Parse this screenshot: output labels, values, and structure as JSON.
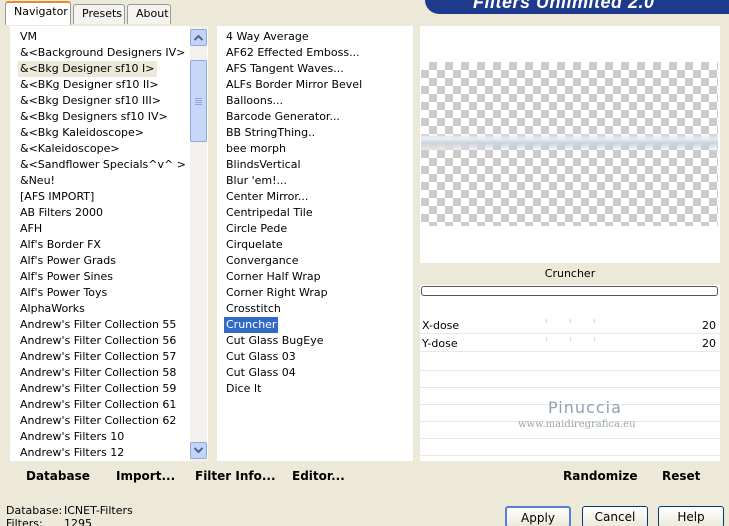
{
  "tabs": [
    "Navigator",
    "Presets",
    "About"
  ],
  "banner_title": "Filters Unlimited 2.0",
  "categories": [
    "VM",
    "&<Background Designers IV>",
    "&<Bkg Designer sf10 I>",
    "&<BKg Designer sf10 II>",
    "&<Bkg Designer sf10 III>",
    "&<Bkg Designers sf10 IV>",
    "&<Bkg Kaleidoscope>",
    "&<Kaleidoscope>",
    "&<Sandflower Specials^v^ >",
    "&Neu!",
    "[AFS IMPORT]",
    "AB Filters 2000",
    "AFH",
    "Alf's Border FX",
    "Alf's Power Grads",
    "Alf's Power Sines",
    "Alf's Power Toys",
    "AlphaWorks",
    "Andrew's Filter Collection 55",
    "Andrew's Filter Collection 56",
    "Andrew's Filter Collection 57",
    "Andrew's Filter Collection 58",
    "Andrew's Filter Collection 59",
    "Andrew's Filter Collection 61",
    "Andrew's Filter Collection 62",
    "Andrew's Filters 10",
    "Andrew's Filters 12"
  ],
  "selected_category": "&<Bkg Designer sf10 I>",
  "filters": [
    "4 Way Average",
    "AF62 Effected Emboss...",
    "AFS Tangent Waves...",
    "ALFs Border Mirror Bevel",
    "Balloons...",
    "Barcode Generator...",
    "BB StringThing..",
    "bee morph",
    "BlindsVertical",
    "Blur 'em!...",
    "Center Mirror...",
    "Centripedal Tile",
    "Circle Pede",
    "Cirquelate",
    "Convergance",
    "Corner Half Wrap",
    "Corner Right Wrap",
    "Crosstitch",
    "Cruncher",
    "Cut Glass  BugEye",
    "Cut Glass 03",
    "Cut Glass 04",
    "Dice It"
  ],
  "selected_filter": "Cruncher",
  "preview": {
    "filter_name": "Cruncher"
  },
  "params": [
    {
      "label": "X-dose",
      "value": "20"
    },
    {
      "label": "Y-dose",
      "value": "20"
    }
  ],
  "watermark": {
    "name": "Pinuccia",
    "url": "www.maidiregrafica.eu"
  },
  "left_buttons": {
    "database": "Database",
    "import": "Import...",
    "filter_info": "Filter Info...",
    "editor": "Editor..."
  },
  "right_buttons": {
    "randomize": "Randomize",
    "reset": "Reset"
  },
  "status": {
    "database_label": "Database:",
    "database_value": "ICNET-Filters",
    "filters_label": "Filters:",
    "filters_value": "1295"
  },
  "dialog_buttons": {
    "apply": "Apply",
    "cancel": "Cancel",
    "help": "Help"
  },
  "colors": {
    "selection": "#316ac5",
    "tab_accent": "#e68b2c",
    "banner": "#1d3a8c",
    "face": "#ece9d8"
  }
}
